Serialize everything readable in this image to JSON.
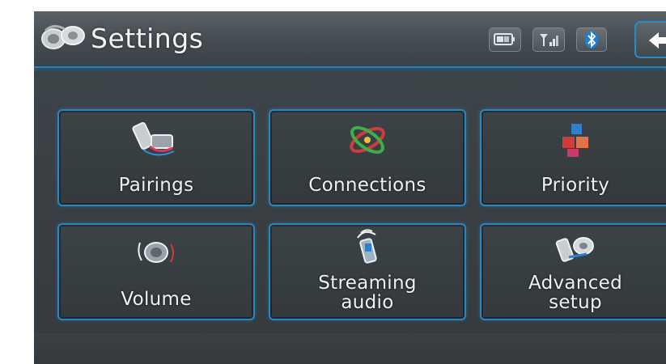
{
  "header": {
    "title": "Settings",
    "status_icons": [
      "phone-battery-icon",
      "signal-strength-icon",
      "bluetooth-icon"
    ],
    "back_icon": "back-arrow-icon"
  },
  "menu": {
    "items": [
      {
        "label": "Pairings",
        "icon": "phone-pairing-icon"
      },
      {
        "label": "Connections",
        "icon": "connections-icon"
      },
      {
        "label": "Priority",
        "icon": "priority-blocks-icon"
      },
      {
        "label": "Volume",
        "icon": "volume-icon"
      },
      {
        "label": "Streaming\naudio",
        "icon": "streaming-audio-icon"
      },
      {
        "label": "Advanced\nsetup",
        "icon": "advanced-setup-icon"
      }
    ]
  },
  "colors": {
    "accent": "#2a86c2",
    "background": "#3a4044",
    "text": "#eef1f2"
  }
}
